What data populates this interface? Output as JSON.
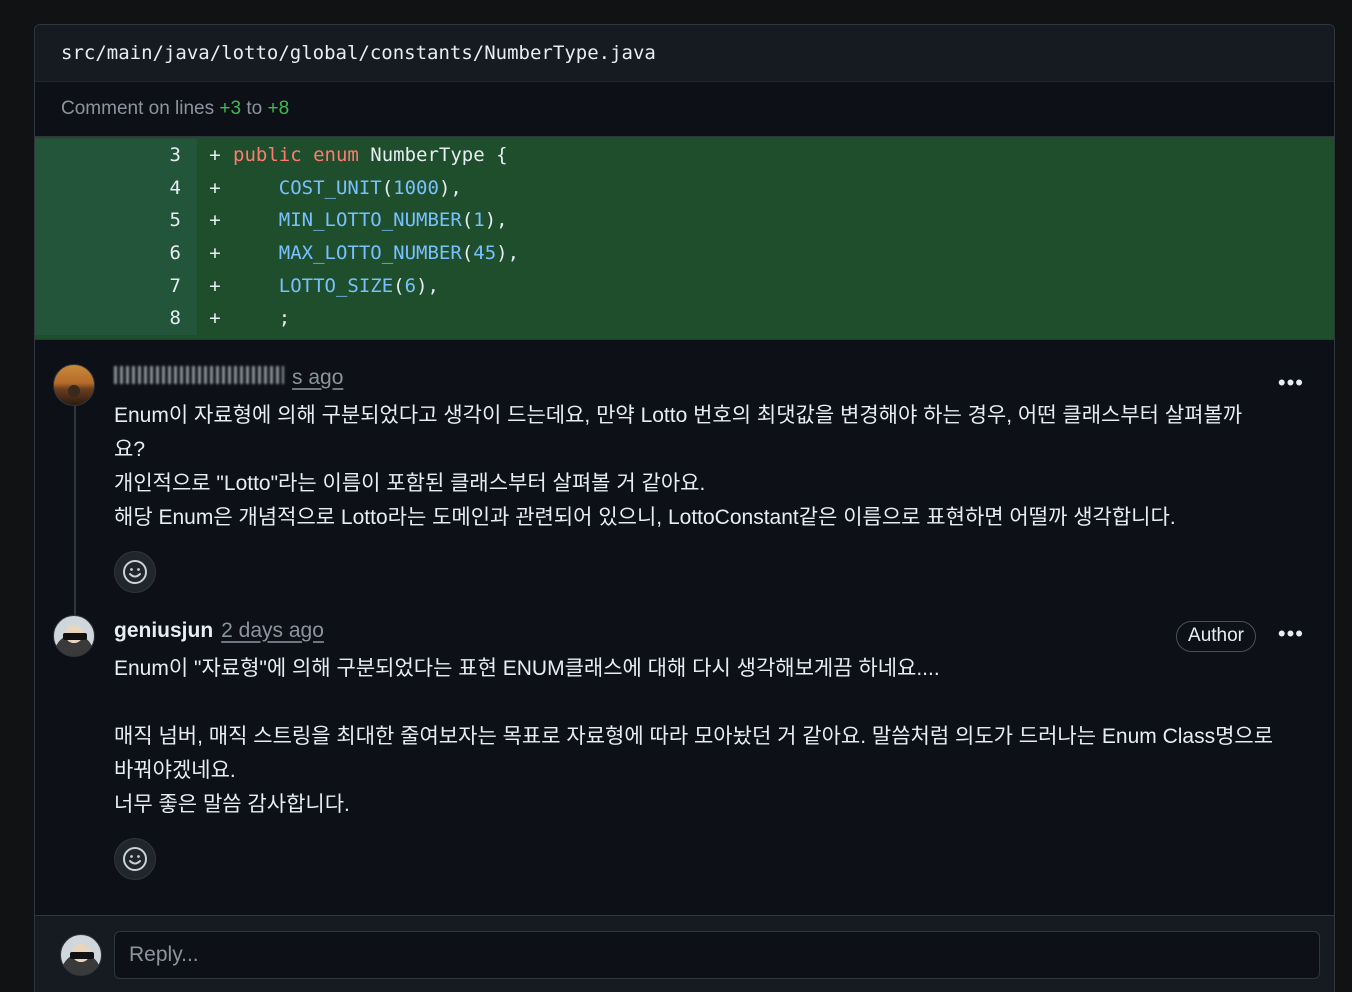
{
  "file": {
    "path": "src/main/java/lotto/global/constants/NumberType.java"
  },
  "range": {
    "prefix": "Comment on lines",
    "start": "+3",
    "mid": "to",
    "end": "+8"
  },
  "code": [
    {
      "num": "3",
      "sign": "+",
      "tokens": [
        [
          "kw",
          "public"
        ],
        [
          "plain",
          " "
        ],
        [
          "kw",
          "enum"
        ],
        [
          "plain",
          " NumberType {"
        ]
      ]
    },
    {
      "num": "4",
      "sign": "+",
      "tokens": [
        [
          "plain",
          "    "
        ],
        [
          "const",
          "COST_UNIT"
        ],
        [
          "plain",
          "("
        ],
        [
          "const",
          "1000"
        ],
        [
          "plain",
          "),"
        ]
      ]
    },
    {
      "num": "5",
      "sign": "+",
      "tokens": [
        [
          "plain",
          "    "
        ],
        [
          "const",
          "MIN_LOTTO_NUMBER"
        ],
        [
          "plain",
          "("
        ],
        [
          "const",
          "1"
        ],
        [
          "plain",
          "),"
        ]
      ]
    },
    {
      "num": "6",
      "sign": "+",
      "tokens": [
        [
          "plain",
          "    "
        ],
        [
          "const",
          "MAX_LOTTO_NUMBER"
        ],
        [
          "plain",
          "("
        ],
        [
          "const",
          "45"
        ],
        [
          "plain",
          "),"
        ]
      ]
    },
    {
      "num": "7",
      "sign": "+",
      "tokens": [
        [
          "plain",
          "    "
        ],
        [
          "const",
          "LOTTO_SIZE"
        ],
        [
          "plain",
          "("
        ],
        [
          "const",
          "6"
        ],
        [
          "plain",
          "),"
        ]
      ]
    },
    {
      "num": "8",
      "sign": "+",
      "tokens": [
        [
          "plain",
          "    ;"
        ]
      ]
    }
  ],
  "comments": [
    {
      "time": "s ago",
      "lines": [
        "Enum이 자료형에 의해 구분되었다고 생각이 드는데요, 만약 Lotto 번호의 최댓값을 변경해야 하는 경우, 어떤 클래스부터 살펴볼까",
        "요?",
        "개인적으로 \"Lotto\"라는 이름이 포함된 클래스부터 살펴볼 거 같아요.",
        "해당 Enum은 개념적으로 Lotto라는 도메인과 관련되어 있으니, LottoConstant같은 이름으로 표현하면 어떨까 생각합니다."
      ],
      "menu": "•••"
    },
    {
      "author": "geniusjun",
      "time": "2 days ago",
      "badge": "Author",
      "lines": [
        "Enum이 \"자료형\"에 의해 구분되었다는 표현 ENUM클래스에 대해 다시 생각해보게끔 하네요....",
        "",
        "매직 넘버, 매직 스트링을 최대한 줄여보자는 목표로 자료형에 따라 모아놨던 거 같아요. 말씀처럼 의도가 드러나는 Enum Class명으로",
        "바꿔야겠네요.",
        "너무 좋은 말씀 감사합니다."
      ],
      "menu": "•••"
    }
  ],
  "reply": {
    "placeholder": "Reply..."
  }
}
